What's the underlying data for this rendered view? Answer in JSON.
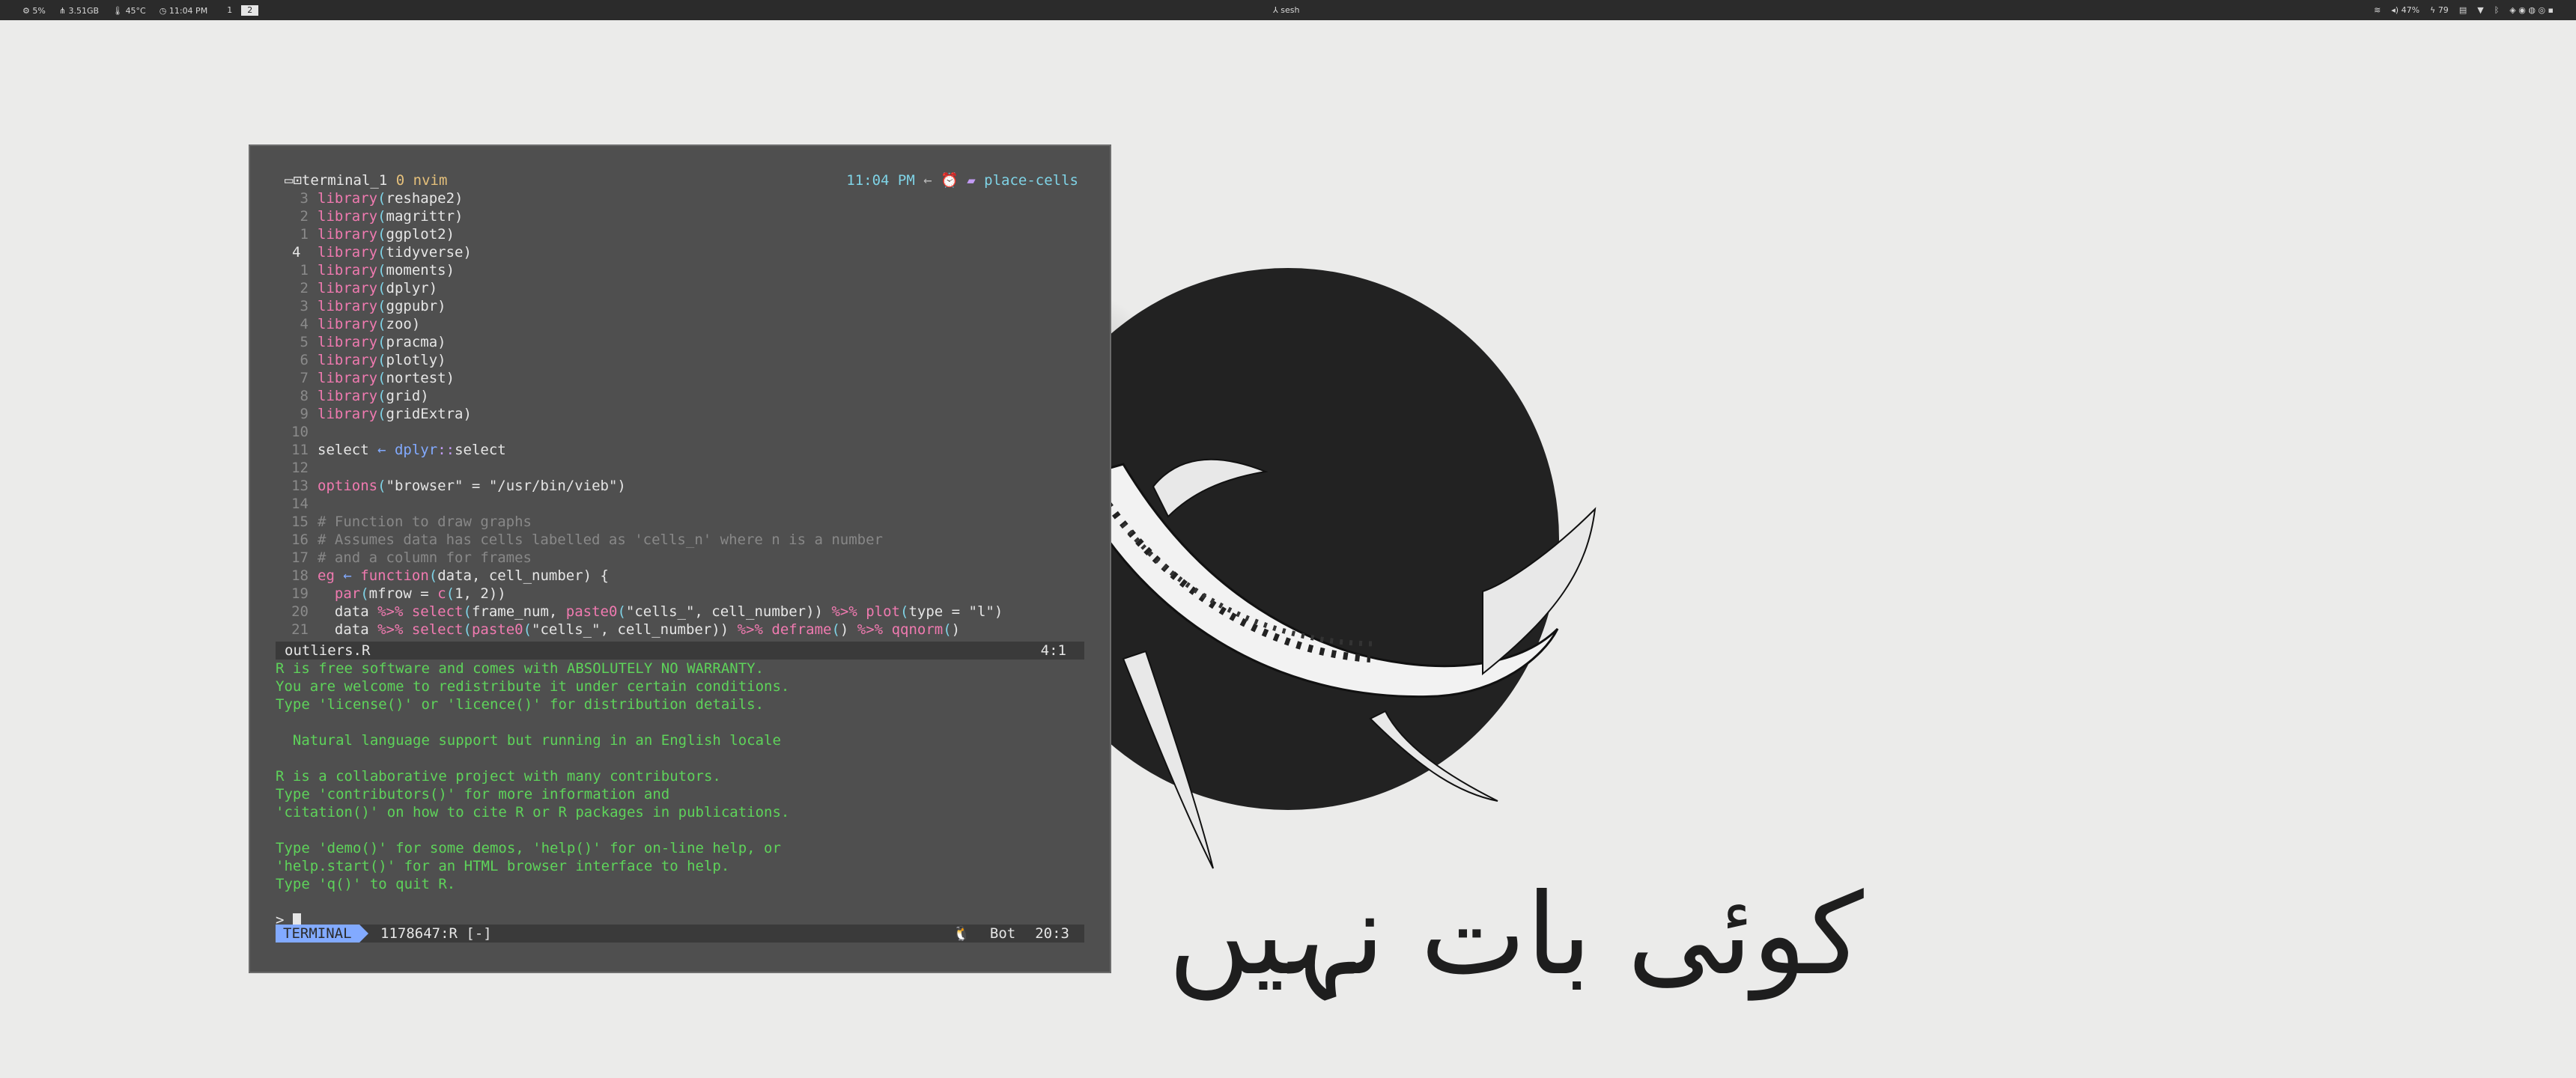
{
  "topbar": {
    "cpu": "5%",
    "mem": "3.51GB",
    "temp": "45°C",
    "clock": "11:04 PM",
    "workspaces": [
      "1",
      "2"
    ],
    "active_workspace": "2",
    "center": "sesh",
    "volume": "47%",
    "battery": "79"
  },
  "tabline": {
    "terminal": "terminal_1",
    "count": "0",
    "app": "nvim",
    "time": "11:04 PM",
    "folder": "place-cells"
  },
  "code_lines": [
    {
      "n": "3",
      "t": "library(reshape2)"
    },
    {
      "n": "2",
      "t": "library(magrittr)"
    },
    {
      "n": "1",
      "t": "library(ggplot2)"
    },
    {
      "n": "4",
      "t": "library(tidyverse)",
      "cur": true
    },
    {
      "n": "1",
      "t": "library(moments)"
    },
    {
      "n": "2",
      "t": "library(dplyr)"
    },
    {
      "n": "3",
      "t": "library(ggpubr)"
    },
    {
      "n": "4",
      "t": "library(zoo)"
    },
    {
      "n": "5",
      "t": "library(pracma)"
    },
    {
      "n": "6",
      "t": "library(plotly)"
    },
    {
      "n": "7",
      "t": "library(nortest)"
    },
    {
      "n": "8",
      "t": "library(grid)"
    },
    {
      "n": "9",
      "t": "library(gridExtra)"
    },
    {
      "n": "10",
      "t": ""
    },
    {
      "n": "11",
      "t": "select ← dplyr::select"
    },
    {
      "n": "12",
      "t": ""
    },
    {
      "n": "13",
      "t": "options(\"browser\" = \"/usr/bin/vieb\")"
    },
    {
      "n": "14",
      "t": ""
    },
    {
      "n": "15",
      "t": "# Function to draw graphs"
    },
    {
      "n": "16",
      "t": "# Assumes data has cells labelled as 'cells_n' where n is a number"
    },
    {
      "n": "17",
      "t": "# and a column for frames"
    },
    {
      "n": "18",
      "t": "eg ← function(data, cell_number) {"
    },
    {
      "n": "19",
      "t": "  par(mfrow = c(1, 2))"
    },
    {
      "n": "20",
      "t": "  data %>% select(frame_num, paste0(\"cells_\", cell_number)) %>% plot(type = \"l\")"
    },
    {
      "n": "21",
      "t": "  data %>% select(paste0(\"cells_\", cell_number)) %>% deframe() %>% qqnorm()"
    }
  ],
  "status1": {
    "file": "outliers.R",
    "pos": "4:1"
  },
  "r_output": [
    "R is free software and comes with ABSOLUTELY NO WARRANTY.",
    "You are welcome to redistribute it under certain conditions.",
    "Type 'license()' or 'licence()' for distribution details.",
    "",
    "  Natural language support but running in an English locale",
    "",
    "R is a collaborative project with many contributors.",
    "Type 'contributors()' for more information and",
    "'citation()' on how to cite R or R packages in publications.",
    "",
    "Type 'demo()' for some demos, 'help()' for on-line help, or",
    "'help.start()' for an HTML browser interface to help.",
    "Type 'q()' to quit R.",
    ""
  ],
  "prompt": ">",
  "status2": {
    "mode": "TERMINAL",
    "file": "1178647:R  [-]",
    "bot": "Bot",
    "pos": "20:3"
  },
  "wallpaper_text": "کوئی بات نہیں"
}
